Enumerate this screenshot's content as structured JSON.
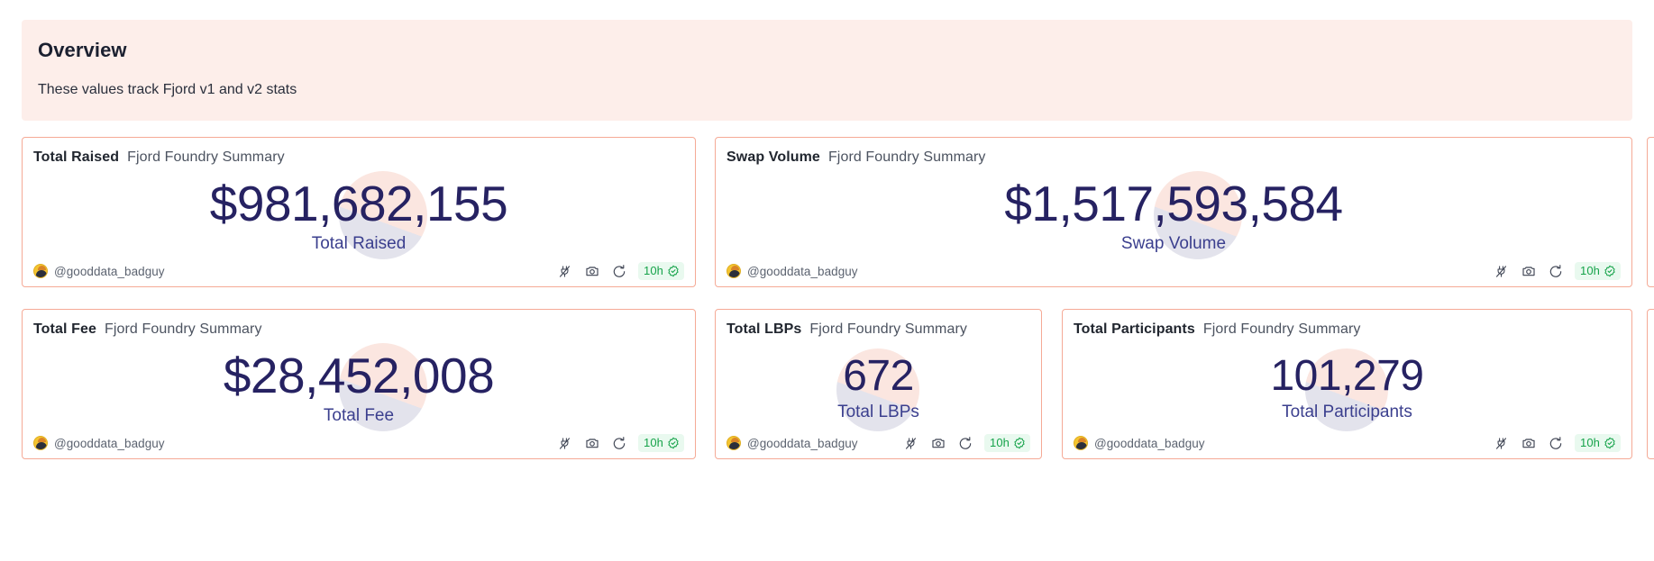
{
  "overview": {
    "title": "Overview",
    "subtitle": "These values track Fjord v1 and v2 stats",
    "background": "#fdeeea"
  },
  "theme": {
    "card_border": "#f5aa96",
    "value_color": "#262262",
    "label_color": "#3b3f8e",
    "badge_bg": "#e9f9ef",
    "badge_text": "#16a34a",
    "decor_pink": "#fbe6e0",
    "decor_gray": "#e3e3ec"
  },
  "footer_common": {
    "author": "@gooddata_badguy",
    "avatar_icon": "user-avatar-icon",
    "actions": [
      {
        "icon": "plug-disconnect-icon",
        "name": "plug-icon"
      },
      {
        "icon": "camera-icon",
        "name": "camera-icon"
      },
      {
        "icon": "refresh-history-icon",
        "name": "refresh-icon"
      }
    ],
    "freshness": "10h",
    "verified_icon": "verified-check-icon"
  },
  "cards": [
    {
      "id": "total-raised",
      "title": "Total Raised",
      "source": "Fjord Foundry Summary",
      "value": "$981,682,155",
      "label": "Total Raised",
      "value_size": "55px",
      "author": "@gooddata_badguy",
      "freshness": "10h"
    },
    {
      "id": "swap-volume",
      "title": "Swap Volume",
      "source": "Fjord Foundry Summary",
      "value": "$1,517,593,584",
      "label": "Swap Volume",
      "value_size": "55px",
      "author": "@gooddata_badguy",
      "freshness": "10h"
    },
    {
      "id": "total-fee",
      "title": "Total Fee",
      "source": "Fjord Foundry Summary",
      "value": "$28,452,008",
      "label": "Total Fee",
      "value_size": "55px",
      "author": "@gooddata_badguy",
      "freshness": "10h"
    },
    {
      "id": "total-lbps",
      "title": "Total LBPs",
      "source": "Fjord Foundry Summary",
      "value": "672",
      "label": "Total LBPs",
      "value_size": "48px",
      "author": "@gooddata_badguy",
      "freshness": "10h"
    },
    {
      "id": "total-participants",
      "title": "Total Participants",
      "source": "Fjord Foundry Summary",
      "value": "101,279",
      "label": "Total Participants",
      "value_size": "48px",
      "author": "@gooddata_badguy",
      "freshness": "10h"
    }
  ]
}
